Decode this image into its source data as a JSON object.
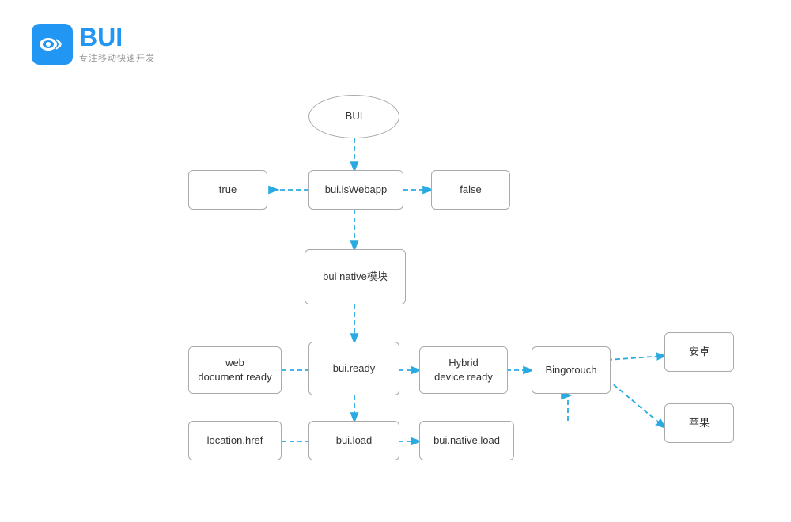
{
  "logo": {
    "title": "BUI",
    "subtitle": "专注移动快速开发"
  },
  "nodes": {
    "bui": {
      "label": "BUI"
    },
    "isWebapp": {
      "label": "bui.isWebapp"
    },
    "true": {
      "label": "true"
    },
    "false": {
      "label": "false"
    },
    "nativeModule": {
      "label": "bui native模块"
    },
    "buiReady": {
      "label": "bui.ready"
    },
    "webDocReady": {
      "label": "web\ndocument ready"
    },
    "hybridReady": {
      "label": "Hybrid\ndevice ready"
    },
    "bingotouch": {
      "label": "Bingotouch"
    },
    "android": {
      "label": "安卓"
    },
    "apple": {
      "label": "苹果"
    },
    "buiLoad": {
      "label": "bui.load"
    },
    "locationHref": {
      "label": "location.href"
    },
    "buiNativeLoad": {
      "label": "bui.native.load"
    }
  },
  "arrowColor": "#29abe2"
}
